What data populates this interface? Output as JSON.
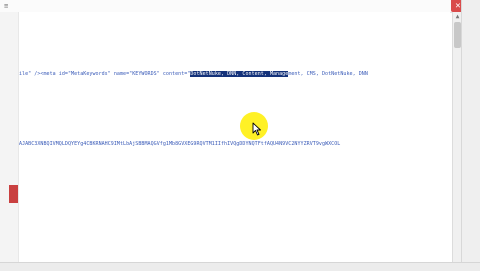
{
  "window": {
    "close_glyph": "✕",
    "menu_glyph": "≡"
  },
  "editor": {
    "line1_prefix": "ile\" /><meta id=\"MetaKeywords\" name=\"KEYWORDS\" content=\"",
    "line1_selected": "DotNetNuke, DNN, Content, Manage",
    "line1_suffix": "ment, CMS, DotNetNuke, DNN",
    "line2": "AJABC3XNBQIVMQLDQYEYg4CBKRNAHC9IMtLbAjSBBMAQGVfg1Mb8GVXEG9RQVTM1IIfhIVQgDDYNQTFtfAQU4N9VC2NYYZRVT9vgWXCOL"
  },
  "colors": {
    "code_text": "#3a5bb8",
    "selection_bg": "#14327a",
    "cursor_halo": "#ffee00",
    "close_button": "#d94b4b",
    "left_indicator": "#c94040"
  },
  "icons": {
    "cursor": "mouse-pointer-icon",
    "close": "close-icon",
    "scroll_up": "chevron-up-icon"
  }
}
